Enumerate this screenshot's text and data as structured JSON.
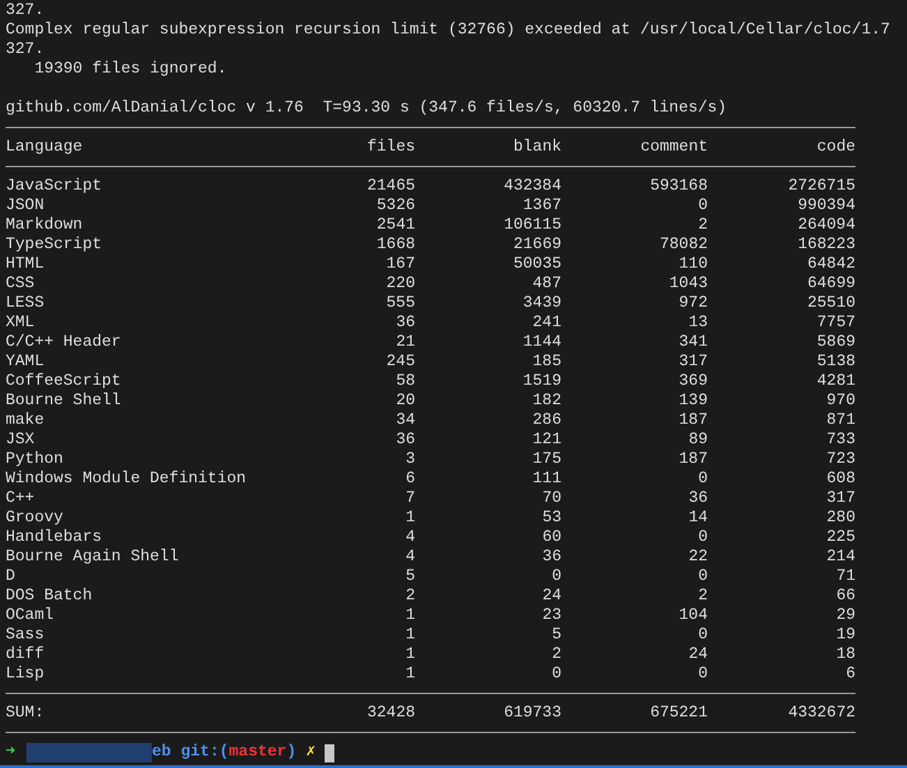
{
  "output_lines": [
    "327.",
    "Complex regular subexpression recursion limit (32766) exceeded at /usr/local/Cellar/cloc/1.7",
    "327.",
    "   19390 files ignored."
  ],
  "version_line": "github.com/AlDanial/cloc v 1.76  T=93.30 s (347.6 files/s, 60320.7 lines/s)",
  "table": {
    "columns": [
      "Language",
      "files",
      "blank",
      "comment",
      "code"
    ],
    "rows": [
      [
        "JavaScript",
        "21465",
        "432384",
        "593168",
        "2726715"
      ],
      [
        "JSON",
        "5326",
        "1367",
        "0",
        "990394"
      ],
      [
        "Markdown",
        "2541",
        "106115",
        "2",
        "264094"
      ],
      [
        "TypeScript",
        "1668",
        "21669",
        "78082",
        "168223"
      ],
      [
        "HTML",
        "167",
        "50035",
        "110",
        "64842"
      ],
      [
        "CSS",
        "220",
        "487",
        "1043",
        "64699"
      ],
      [
        "LESS",
        "555",
        "3439",
        "972",
        "25510"
      ],
      [
        "XML",
        "36",
        "241",
        "13",
        "7757"
      ],
      [
        "C/C++ Header",
        "21",
        "1144",
        "341",
        "5869"
      ],
      [
        "YAML",
        "245",
        "185",
        "317",
        "5138"
      ],
      [
        "CoffeeScript",
        "58",
        "1519",
        "369",
        "4281"
      ],
      [
        "Bourne Shell",
        "20",
        "182",
        "139",
        "970"
      ],
      [
        "make",
        "34",
        "286",
        "187",
        "871"
      ],
      [
        "JSX",
        "36",
        "121",
        "89",
        "733"
      ],
      [
        "Python",
        "3",
        "175",
        "187",
        "723"
      ],
      [
        "Windows Module Definition",
        "6",
        "111",
        "0",
        "608"
      ],
      [
        "C++",
        "7",
        "70",
        "36",
        "317"
      ],
      [
        "Groovy",
        "1",
        "53",
        "14",
        "280"
      ],
      [
        "Handlebars",
        "4",
        "60",
        "0",
        "225"
      ],
      [
        "Bourne Again Shell",
        "4",
        "36",
        "22",
        "214"
      ],
      [
        "D",
        "5",
        "0",
        "0",
        "71"
      ],
      [
        "DOS Batch",
        "2",
        "24",
        "2",
        "66"
      ],
      [
        "OCaml",
        "1",
        "23",
        "104",
        "29"
      ],
      [
        "Sass",
        "1",
        "5",
        "0",
        "19"
      ],
      [
        "diff",
        "1",
        "2",
        "24",
        "18"
      ],
      [
        "Lisp",
        "1",
        "0",
        "0",
        "6"
      ]
    ],
    "sum": [
      "SUM:",
      "32428",
      "619733",
      "675221",
      "4332672"
    ]
  },
  "prompt": {
    "arrow": "➜",
    "directory": "eb",
    "git_label": "git:(",
    "branch": "master",
    "git_close": ")",
    "dirty_mark": "✗"
  }
}
